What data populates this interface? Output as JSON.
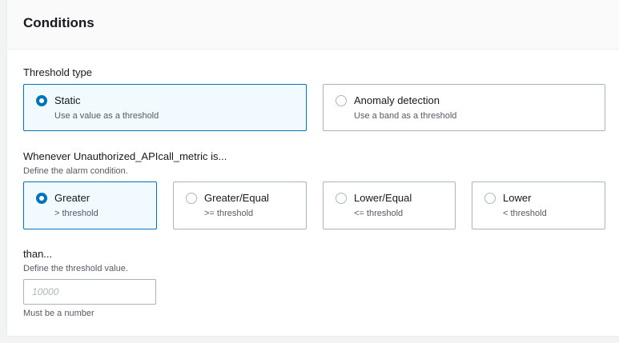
{
  "section": {
    "title": "Conditions"
  },
  "threshold_type": {
    "label": "Threshold type",
    "options": [
      {
        "label": "Static",
        "description": "Use a value as a threshold",
        "selected": true
      },
      {
        "label": "Anomaly detection",
        "description": "Use a band as a threshold",
        "selected": false
      }
    ]
  },
  "condition": {
    "label": "Whenever Unauthorized_APIcall_metric is...",
    "description": "Define the alarm condition.",
    "options": [
      {
        "label": "Greater",
        "description": "> threshold",
        "selected": true
      },
      {
        "label": "Greater/Equal",
        "description": ">= threshold",
        "selected": false
      },
      {
        "label": "Lower/Equal",
        "description": "<= threshold",
        "selected": false
      },
      {
        "label": "Lower",
        "description": "< threshold",
        "selected": false
      }
    ]
  },
  "threshold_value": {
    "label": "than...",
    "description": "Define the threshold value.",
    "value": "",
    "placeholder": "10000",
    "constraint": "Must be a number"
  },
  "colors": {
    "accent": "#0073bb",
    "selected_bg": "#f1faff",
    "border": "#aab7b8",
    "secondary_text": "#545b64"
  }
}
